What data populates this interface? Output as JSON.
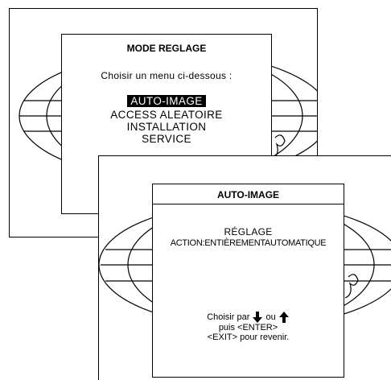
{
  "back_panel": {
    "title": "MODE REGLAGE",
    "prompt": "Choisir un menu ci-dessous :",
    "items": [
      {
        "label": "AUTO-IMAGE",
        "selected": true
      },
      {
        "label": "ACCESS ALEATOIRE",
        "selected": false
      },
      {
        "label": "INSTALLATION",
        "selected": false
      },
      {
        "label": "SERVICE",
        "selected": false
      }
    ]
  },
  "front_panel": {
    "title": "AUTO-IMAGE",
    "setting_label": "RÉGLAGE",
    "action_text": "ACTION:ENTIÈREMENTAUTOMATIQUE",
    "footer_line1_prefix": "Choisir par",
    "footer_line1_or": "ou",
    "footer_line2": "puis <ENTER>",
    "footer_line3": "<EXIT> pour revenir."
  },
  "icons": [
    "globe-grid-icon",
    "arrow-down-icon",
    "arrow-up-icon"
  ]
}
